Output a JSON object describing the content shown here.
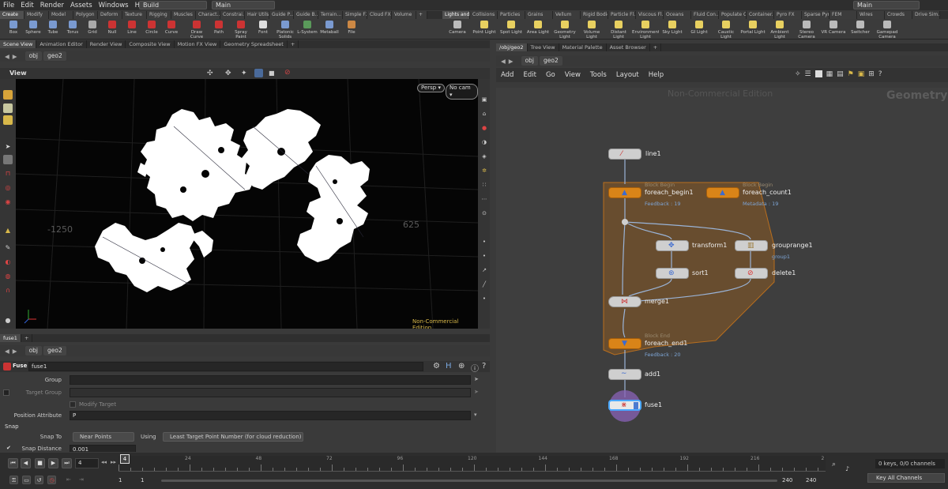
{
  "menubar": {
    "items": [
      "File",
      "Edit",
      "Render",
      "Assets",
      "Windows",
      "Help"
    ],
    "desktop": "Build",
    "main": "Main",
    "right_main": "Main"
  },
  "shelf_tabs_left": [
    "Create",
    "Modify",
    "Model",
    "Polygon",
    "Deform",
    "Texture",
    "Rigging",
    "Muscles",
    "Charact...",
    "Constrai...",
    "Hair Utils",
    "Guide P...",
    "Guide B...",
    "Terrain...",
    "Simple FX",
    "Cloud FX",
    "Volume",
    "+"
  ],
  "shelf_tabs_right": [
    "Lights and...",
    "Collisions",
    "Particles",
    "Grains",
    "Vellum",
    "Rigid Bodies",
    "Particle Fl...",
    "Viscous Fl...",
    "Oceans",
    "Fluid Con...",
    "Populate C...",
    "Container...",
    "Pyro FX",
    "Sparse Pyr...",
    "FEM",
    "Wires",
    "Crowds",
    "Drive Sim..."
  ],
  "tools_left": [
    "Box",
    "Sphere",
    "Tube",
    "Torus",
    "Grid",
    "Null",
    "Line",
    "Circle",
    "Curve",
    "Draw Curve",
    "Path",
    "Spray Paint",
    "Font",
    "Platonic Solids",
    "L-System",
    "Metaball",
    "File"
  ],
  "tools_right": [
    "Camera",
    "Point Light",
    "Spot Light",
    "Area Light",
    "Geometry Light",
    "Volume Light",
    "Distant Light",
    "Environment Light",
    "Sky Light",
    "GI Light",
    "Caustic Light",
    "Portal Light",
    "Ambient Light",
    "Stereo Camera",
    "VR Camera",
    "Switcher",
    "Gamepad Camera"
  ],
  "left_pane_tabs": [
    "Scene View",
    "Animation Editor",
    "Render View",
    "Composite View",
    "Motion FX View",
    "Geometry Spreadsheet",
    "+"
  ],
  "right_pane_tabs": [
    "/obj/geo2",
    "Tree View",
    "Material Palette",
    "Asset Browser",
    "+"
  ],
  "path": {
    "obj": "obj",
    "geo": "geo2"
  },
  "viewport": {
    "title": "View",
    "persp": "Persp",
    "cam": "No cam",
    "label_neg": "-1250",
    "label_pos": "625",
    "watermark": "Non-Commercial Edition"
  },
  "network": {
    "menu": [
      "Add",
      "Edit",
      "Go",
      "View",
      "Tools",
      "Layout",
      "Help"
    ],
    "watermark": "Non-Commercial Edition",
    "context": "Geometry",
    "nodes": {
      "line1": "line1",
      "foreach_begin1": "foreach_begin1",
      "foreach_count1": "foreach_count1",
      "block_begin": "Block Begin",
      "feedback19": "Feedback : 19",
      "metadata19": "Metadata : 19",
      "transform1": "transform1",
      "grouprange1": "grouprange1",
      "group1": "group1",
      "sort1": "sort1",
      "delete1": "delete1",
      "merge1": "merge1",
      "block_end": "Block End",
      "foreach_end1": "foreach_end1",
      "feedback20": "Feedback : 20",
      "add1": "add1",
      "fuse1": "fuse1"
    }
  },
  "params": {
    "tab": "fuse1",
    "type": "Fuse",
    "name": "fuse1",
    "group_label": "Group",
    "target_group_label": "Target Group",
    "modify_target_label": "Modify Target",
    "position_attr_label": "Position Attribute",
    "position_attr_value": "P",
    "snap_section": "Snap",
    "snap_to_label": "Snap To",
    "snap_to_value": "Near Points",
    "using_label": "Using",
    "using_value": "Least Target Point Number (for cloud reduction)",
    "snap_distance_label": "Snap Distance",
    "snap_distance_value": "0.001"
  },
  "timeline": {
    "frame": "4",
    "current_marker": "4",
    "ticks": [
      "24",
      "48",
      "72",
      "96",
      "120",
      "144",
      "168",
      "192",
      "216",
      "2"
    ],
    "start": "1",
    "start2": "1",
    "end": "240",
    "end2": "240",
    "keys_info": "0 keys, 0/0 channels",
    "key_all": "Key All Channels"
  }
}
